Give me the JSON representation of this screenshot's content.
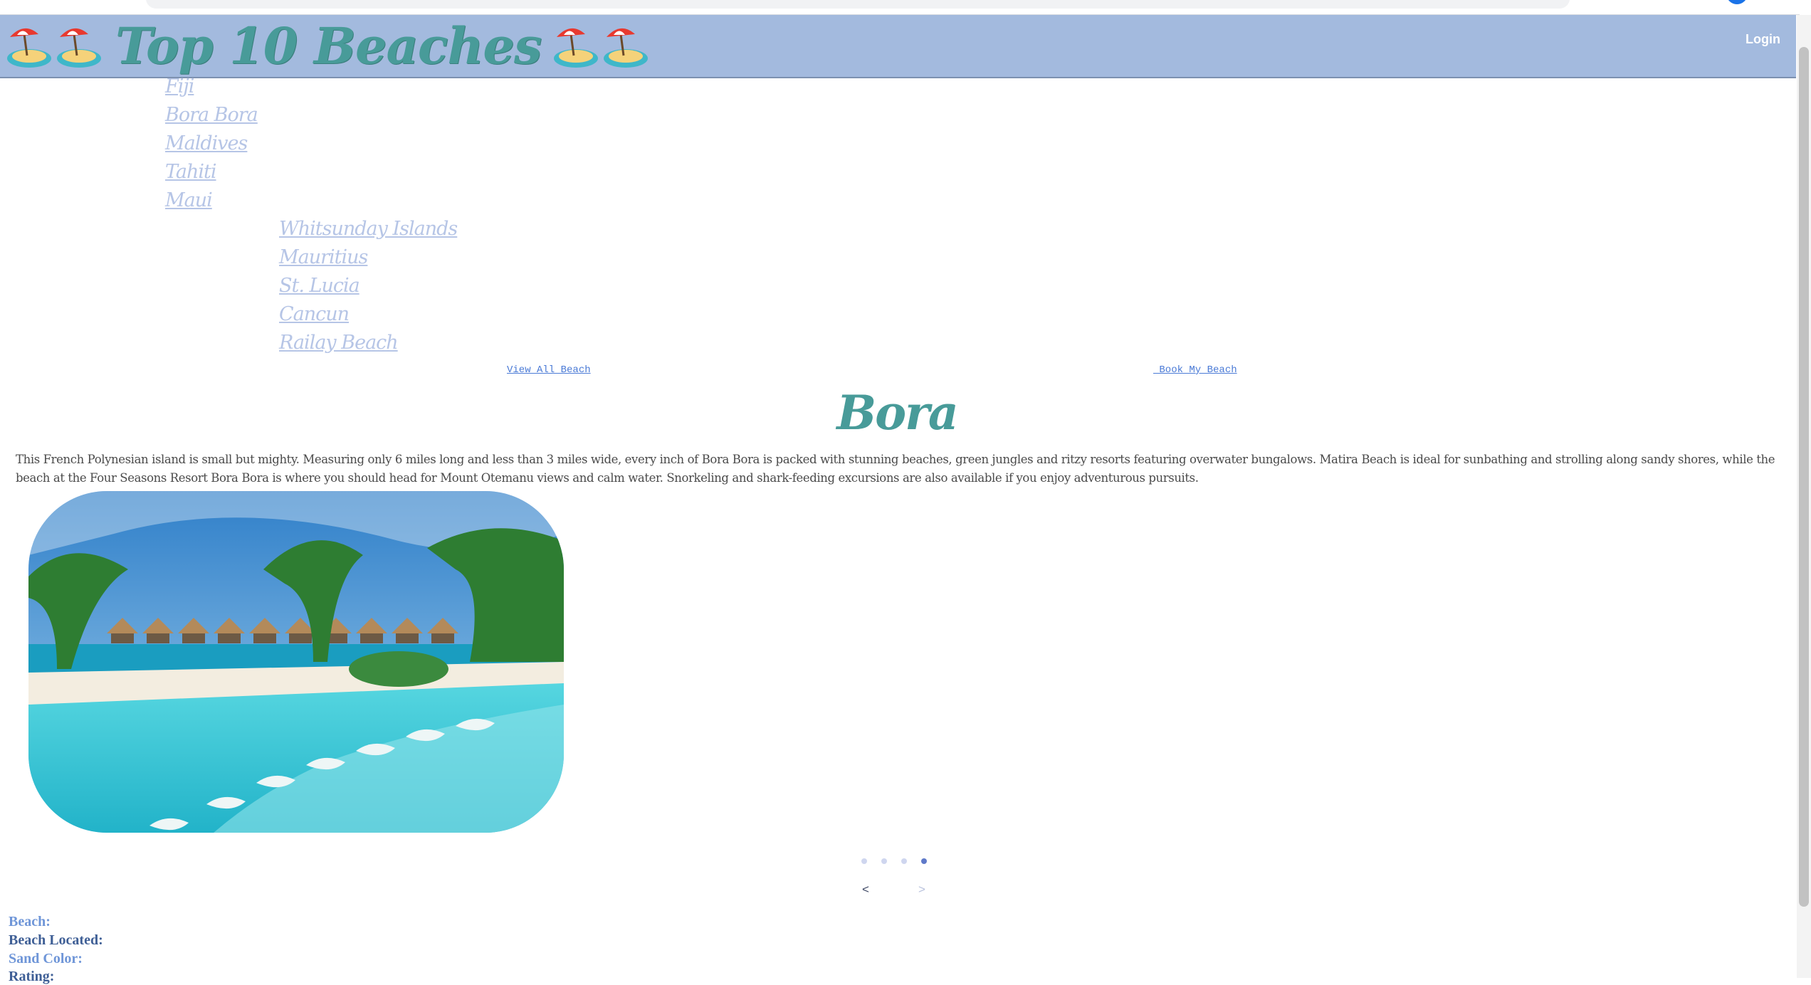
{
  "header": {
    "title": "Top 10 Beaches",
    "login_label": "Login",
    "brand_color": "#489b99",
    "header_bg": "#a3bade",
    "icon_name": "beach-umbrella-island-icon"
  },
  "nav": {
    "group_one": [
      "Fiji",
      "Bora Bora",
      "Maldives",
      "Tahiti",
      "Maui"
    ],
    "group_two": [
      "Whitsunday Islands",
      "Mauritius",
      "St. Lucia",
      "Cancun",
      "Railay Beach"
    ]
  },
  "links": {
    "view_all": "View All Beach",
    "book": " Book My Beach"
  },
  "beach": {
    "title": "Bora",
    "description": "This French Polynesian island is small but mighty. Measuring only 6 miles long and less than 3 miles wide, every inch of Bora Bora is packed with stunning beaches, green jungles and ritzy resorts featuring overwater bungalows. Matira Beach is ideal for sunbathing and strolling along sandy shores, while the beach at the Four Seasons Resort Bora Bora is where you should head for Mount Otemanu views and calm water. Snorkeling and shark-feeding excursions are also available if you enjoy adventurous pursuits."
  },
  "carousel": {
    "slide_count": 4,
    "active_index": 4,
    "prev_label": "<",
    "next_label": ">"
  },
  "details": {
    "beach_label": "Beach:",
    "located_label": "Beach Located:",
    "sand_label": "Sand Color:",
    "rating_label": "Rating:"
  }
}
